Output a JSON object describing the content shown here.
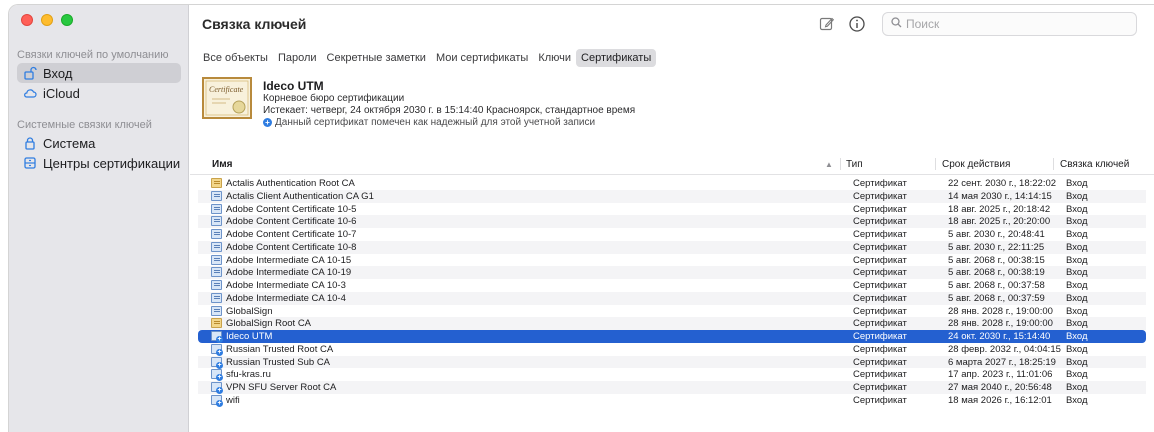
{
  "window": {
    "title": "Связка ключей",
    "search_placeholder": "Поиск"
  },
  "sidebar": {
    "default_section": "Связки ключей по умолчанию",
    "default_items": [
      {
        "label": "Вход",
        "icon": "lock-open-icon",
        "selected": true
      },
      {
        "label": "iCloud",
        "icon": "cloud-icon",
        "selected": false
      }
    ],
    "system_section": "Системные связки ключей",
    "system_items": [
      {
        "label": "Система",
        "icon": "lock-icon"
      },
      {
        "label": "Центры сертификации",
        "icon": "cabinet-icon"
      }
    ]
  },
  "tabs": [
    {
      "label": "Все объекты",
      "active": false
    },
    {
      "label": "Пароли",
      "active": false
    },
    {
      "label": "Секретные заметки",
      "active": false
    },
    {
      "label": "Мои сертификаты",
      "active": false
    },
    {
      "label": "Ключи",
      "active": false
    },
    {
      "label": "Сертификаты",
      "active": true
    }
  ],
  "details": {
    "name": "Ideco UTM",
    "kind": "Корневое бюро сертификации",
    "expires": "Истекает: четверг, 24 октября 2030 г. в 15:14:40 Красноярск, стандартное время",
    "trust": "Данный сертификат помечен как надежный для этой учетной записи",
    "thumb_text": "Certificate"
  },
  "table": {
    "columns": {
      "name": "Имя",
      "type": "Тип",
      "expires": "Срок действия",
      "keychain": "Связка ключей"
    },
    "rows": [
      {
        "name": "Actalis Authentication Root CA",
        "type": "Сертификат",
        "expires": "22 сент. 2030 г., 18:22:02",
        "keychain": "Вход",
        "icon": "gold"
      },
      {
        "name": "Actalis Client Authentication CA G1",
        "type": "Сертификат",
        "expires": "14 мая 2030 г., 14:14:15",
        "keychain": "Вход",
        "icon": "blue"
      },
      {
        "name": "Adobe Content Certificate 10-5",
        "type": "Сертификат",
        "expires": "18 авг. 2025 г., 20:18:42",
        "keychain": "Вход",
        "icon": "blue"
      },
      {
        "name": "Adobe Content Certificate 10-6",
        "type": "Сертификат",
        "expires": "18 авг. 2025 г., 20:20:00",
        "keychain": "Вход",
        "icon": "blue"
      },
      {
        "name": "Adobe Content Certificate 10-7",
        "type": "Сертификат",
        "expires": "5 авг. 2030 г., 20:48:41",
        "keychain": "Вход",
        "icon": "blue"
      },
      {
        "name": "Adobe Content Certificate 10-8",
        "type": "Сертификат",
        "expires": "5 авг. 2030 г., 22:11:25",
        "keychain": "Вход",
        "icon": "blue"
      },
      {
        "name": "Adobe Intermediate CA 10-15",
        "type": "Сертификат",
        "expires": "5 авг. 2068 г., 00:38:15",
        "keychain": "Вход",
        "icon": "blue"
      },
      {
        "name": "Adobe Intermediate CA 10-19",
        "type": "Сертификат",
        "expires": "5 авг. 2068 г., 00:38:19",
        "keychain": "Вход",
        "icon": "blue"
      },
      {
        "name": "Adobe Intermediate CA 10-3",
        "type": "Сертификат",
        "expires": "5 авг. 2068 г., 00:37:58",
        "keychain": "Вход",
        "icon": "blue"
      },
      {
        "name": "Adobe Intermediate CA 10-4",
        "type": "Сертификат",
        "expires": "5 авг. 2068 г., 00:37:59",
        "keychain": "Вход",
        "icon": "blue"
      },
      {
        "name": "GlobalSign",
        "type": "Сертификат",
        "expires": "28 янв. 2028 г., 19:00:00",
        "keychain": "Вход",
        "icon": "blue"
      },
      {
        "name": "GlobalSign Root CA",
        "type": "Сертификат",
        "expires": "28 янв. 2028 г., 19:00:00",
        "keychain": "Вход",
        "icon": "gold"
      },
      {
        "name": "Ideco UTM",
        "type": "Сертификат",
        "expires": "24 окт. 2030 г., 15:14:40",
        "keychain": "Вход",
        "icon": "trust",
        "selected": true
      },
      {
        "name": "Russian Trusted Root CA",
        "type": "Сертификат",
        "expires": "28 февр. 2032 г., 04:04:15",
        "keychain": "Вход",
        "icon": "trust"
      },
      {
        "name": "Russian Trusted Sub CA",
        "type": "Сертификат",
        "expires": "6 марта 2027 г., 18:25:19",
        "keychain": "Вход",
        "icon": "trust"
      },
      {
        "name": "sfu-kras.ru",
        "type": "Сертификат",
        "expires": "17 апр. 2023 г., 11:01:06",
        "keychain": "Вход",
        "icon": "trust"
      },
      {
        "name": "VPN SFU Server Root CA",
        "type": "Сертификат",
        "expires": "27 мая 2040 г., 20:56:48",
        "keychain": "Вход",
        "icon": "trust"
      },
      {
        "name": "wifi",
        "type": "Сертификат",
        "expires": "18 мая 2026 г., 16:12:01",
        "keychain": "Вход",
        "icon": "trust"
      }
    ]
  },
  "colors": {
    "selection": "#2460d0",
    "sidebar_bg": "#e6e6ea",
    "accent": "#2f7de1"
  }
}
